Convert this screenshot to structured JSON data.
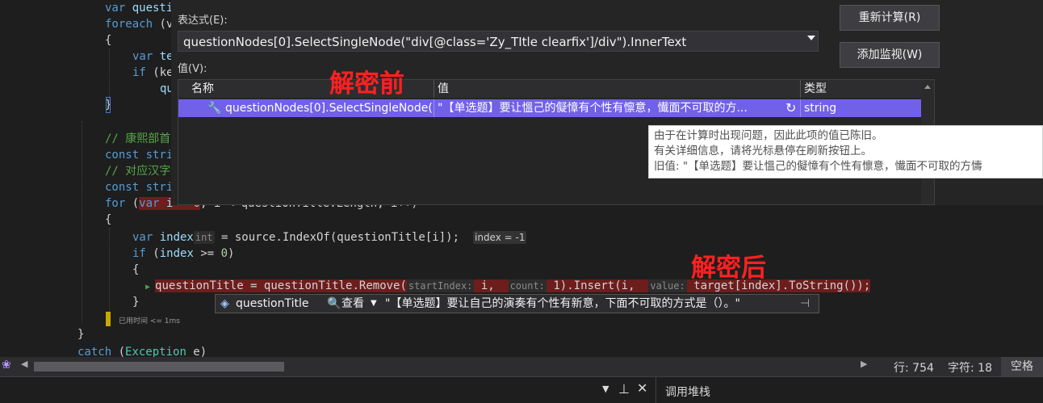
{
  "editor": {
    "lines": [
      {
        "parts": [
          [
            "kw",
            "var "
          ],
          [
            "var",
            "questi"
          ]
        ]
      },
      {
        "parts": [
          [
            "kw",
            "foreach "
          ],
          [
            "",
            "(v"
          ]
        ]
      },
      {
        "parts": [
          [
            "",
            "{"
          ]
        ]
      },
      {
        "parts": [
          [
            "kw",
            "var "
          ],
          [
            "var",
            "te"
          ]
        ]
      },
      {
        "parts": [
          [
            "kw",
            "if "
          ],
          [
            "",
            "(ke"
          ]
        ]
      },
      {
        "parts": [
          [
            "var",
            "qu"
          ]
        ]
      },
      {
        "parts": [
          [
            "",
            "}"
          ]
        ]
      },
      {
        "parts": [
          [
            "",
            ""
          ]
        ]
      },
      {
        "parts": [
          [
            "cm",
            "// 康熙部首"
          ]
        ]
      },
      {
        "parts": [
          [
            "kw",
            "const "
          ],
          [
            "kw",
            "stri"
          ]
        ]
      },
      {
        "parts": [
          [
            "cm",
            "// 对应汉字"
          ]
        ]
      },
      {
        "parts": [
          [
            "kw",
            "const "
          ],
          [
            "kw",
            "stri"
          ]
        ]
      },
      {
        "parts": [
          [
            "kw",
            "for "
          ],
          [
            "",
            "("
          ],
          [
            "kw",
            "var "
          ],
          [
            "var",
            "i"
          ],
          [
            "",
            " = "
          ],
          [
            "num",
            "0"
          ],
          [
            "",
            "; i < questionTitle.Length; i++)"
          ]
        ]
      },
      {
        "parts": [
          [
            "",
            "{"
          ]
        ]
      },
      {
        "parts": [
          [
            "kw",
            "var "
          ],
          [
            "var",
            "index"
          ]
        ]
      },
      {
        "parts": [
          [
            "kw",
            "if "
          ],
          [
            "",
            "("
          ],
          [
            "var",
            "index"
          ],
          [
            "",
            " >= "
          ],
          [
            "num",
            "0"
          ],
          [
            "",
            ")"
          ]
        ]
      },
      {
        "parts": [
          [
            "",
            "{"
          ]
        ]
      },
      {
        "parts": [
          [
            "var",
            "questionTitle"
          ]
        ]
      },
      {
        "parts": [
          [
            "",
            "}"
          ]
        ]
      },
      {
        "parts": [
          [
            "",
            "}"
          ]
        ]
      },
      {
        "parts": [
          [
            "",
            "}"
          ]
        ]
      },
      {
        "parts": [
          [
            "kw",
            "catch "
          ],
          [
            "",
            "("
          ],
          [
            "ty",
            "Exception"
          ],
          [
            "",
            " e)"
          ]
        ]
      }
    ],
    "line14_rest": " = source.IndexOf(questionTitle[i]);",
    "line14_hint": "int",
    "index_badge": "index = -1",
    "line17_code_a": "questionTitle = questionTitle.Remove(",
    "hint_startIndex": "startIndex:",
    "code_i": " i,",
    "hint_count": "count:",
    "code_insert": " 1).Insert(i,",
    "hint_value": "value:",
    "code_target": " target[index].ToString());",
    "elapsed": "已用时间 <= 1ms"
  },
  "quickwatch": {
    "expr_label": "表达式(E):",
    "expr_value": "questionNodes[0].SelectSingleNode(\"div[@class='Zy_TItle clearfix']/div\").InnerText",
    "value_label": "值(V):",
    "recalc_button": "重新计算(R)",
    "add_watch_button": "添加监视(W)",
    "columns": {
      "name": "名称",
      "value": "值",
      "type": "类型"
    },
    "row": {
      "name": "questionNodes[0].SelectSingleNode(...",
      "value": "\"【单选题】要让慍己的儗慞有个性有懔意，懴面不可取的方...",
      "type": "string"
    }
  },
  "tooltip": {
    "line1": "由于在计算时出现问题，因此此项的值已陈旧。",
    "line2": "有关详细信息，请将光标悬停在刷新按钮上。",
    "line3": "旧值: \"【单选题】要让慍己的儗慞有个性有懔意，懴面不可取的方懤"
  },
  "annotations": {
    "before": "解密前",
    "after": "解密后"
  },
  "datatip": {
    "name": "questionTitle",
    "view_label": "查看",
    "value": "\"【单选题】要让自己的演奏有个性有新意，下面不可取的方式是（）。\""
  },
  "status": {
    "line": "行: 754",
    "char": "字符: 18",
    "space": "空格"
  },
  "bottom_panel": {
    "title": "调用堆栈"
  },
  "colors": {
    "selection": "#7160e8",
    "annotation": "#ff2020",
    "highlight": "#6e1d1d"
  }
}
